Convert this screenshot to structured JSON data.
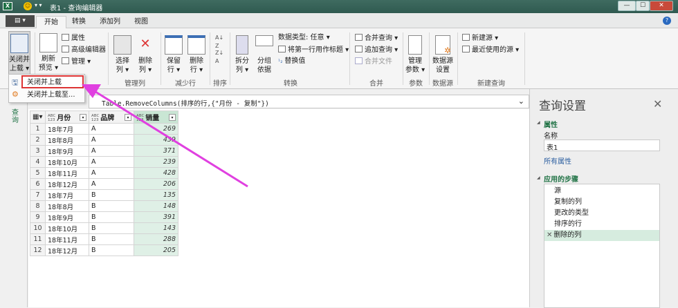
{
  "window": {
    "title": "表1 - 查询编辑器",
    "minimize": "—",
    "maximize": "☐",
    "close": "✕",
    "app_icon": "X∥"
  },
  "tabs": {
    "file": "▤ ▾",
    "items": [
      "开始",
      "转换",
      "添加列",
      "视图"
    ],
    "help": "?"
  },
  "ribbon": {
    "close_load": "关闭并\n上载 ▾",
    "close_load_l1": "关闭并",
    "close_load_l2": "上载 ▾",
    "refresh_l1": "刷新",
    "refresh_l2": "预览 ▾",
    "properties": "属性",
    "advanced_editor": "高级编辑器",
    "manage": "管理 ▾",
    "choose_cols_l1": "选择",
    "choose_cols_l2": "列 ▾",
    "remove_cols_l1": "删除",
    "remove_cols_l2": "列 ▾",
    "keep_rows_l1": "保留",
    "keep_rows_l2": "行 ▾",
    "remove_rows_l1": "删除",
    "remove_rows_l2": "行 ▾",
    "split_l1": "拆分",
    "split_l2": "列 ▾",
    "group_l1": "分组",
    "group_l2": "依据",
    "data_type": "数据类型: 任意 ▾",
    "first_row_header": "将第一行用作标题 ▾",
    "replace_values": "替换值",
    "merge_queries": "合并查询 ▾",
    "append_queries": "追加查询 ▾",
    "combine_files": "合并文件",
    "manage_params_l1": "管理",
    "manage_params_l2": "参数 ▾",
    "ds_settings_l1": "数据源",
    "ds_settings_l2": "设置",
    "new_source": "新建源 ▾",
    "recent_sources": "最近使用的源 ▾",
    "groups": {
      "manage_cols": "管理列",
      "reduce_rows": "减少行",
      "sort": "排序",
      "transform": "转换",
      "combine": "合并",
      "params": "参数",
      "datasource": "数据源",
      "new_query": "新建查询"
    }
  },
  "menu": {
    "items": [
      "关闭并上载",
      "关闭并上载至..."
    ]
  },
  "left_pane": {
    "label": "查询"
  },
  "formula": {
    "text": "Table.RemoveColumns(排序的行,{\"月份 - 复制\"})",
    "expand": "⌄"
  },
  "table": {
    "columns": [
      "月份",
      "品牌",
      "销量"
    ],
    "type_label": "ABC\n123",
    "rows": [
      [
        "18年7月",
        "A",
        "269"
      ],
      [
        "18年8月",
        "A",
        "439"
      ],
      [
        "18年9月",
        "A",
        "371"
      ],
      [
        "18年10月",
        "A",
        "239"
      ],
      [
        "18年11月",
        "A",
        "428"
      ],
      [
        "18年12月",
        "A",
        "206"
      ],
      [
        "18年7月",
        "B",
        "135"
      ],
      [
        "18年8月",
        "B",
        "148"
      ],
      [
        "18年9月",
        "B",
        "391"
      ],
      [
        "18年10月",
        "B",
        "143"
      ],
      [
        "18年11月",
        "B",
        "288"
      ],
      [
        "18年12月",
        "B",
        "205"
      ]
    ]
  },
  "settings": {
    "title": "查询设置",
    "close": "✕",
    "properties_header": "属性",
    "name_label": "名称",
    "name_value": "表1",
    "all_properties": "所有属性",
    "steps_header": "应用的步骤",
    "steps": [
      "源",
      "复制的列",
      "更改的类型",
      "排序的行",
      "删除的列"
    ],
    "selected_step_icon": "✕"
  },
  "colors": {
    "accent": "#217346",
    "highlight": "#dd3333",
    "arrow": "#e040e0"
  }
}
